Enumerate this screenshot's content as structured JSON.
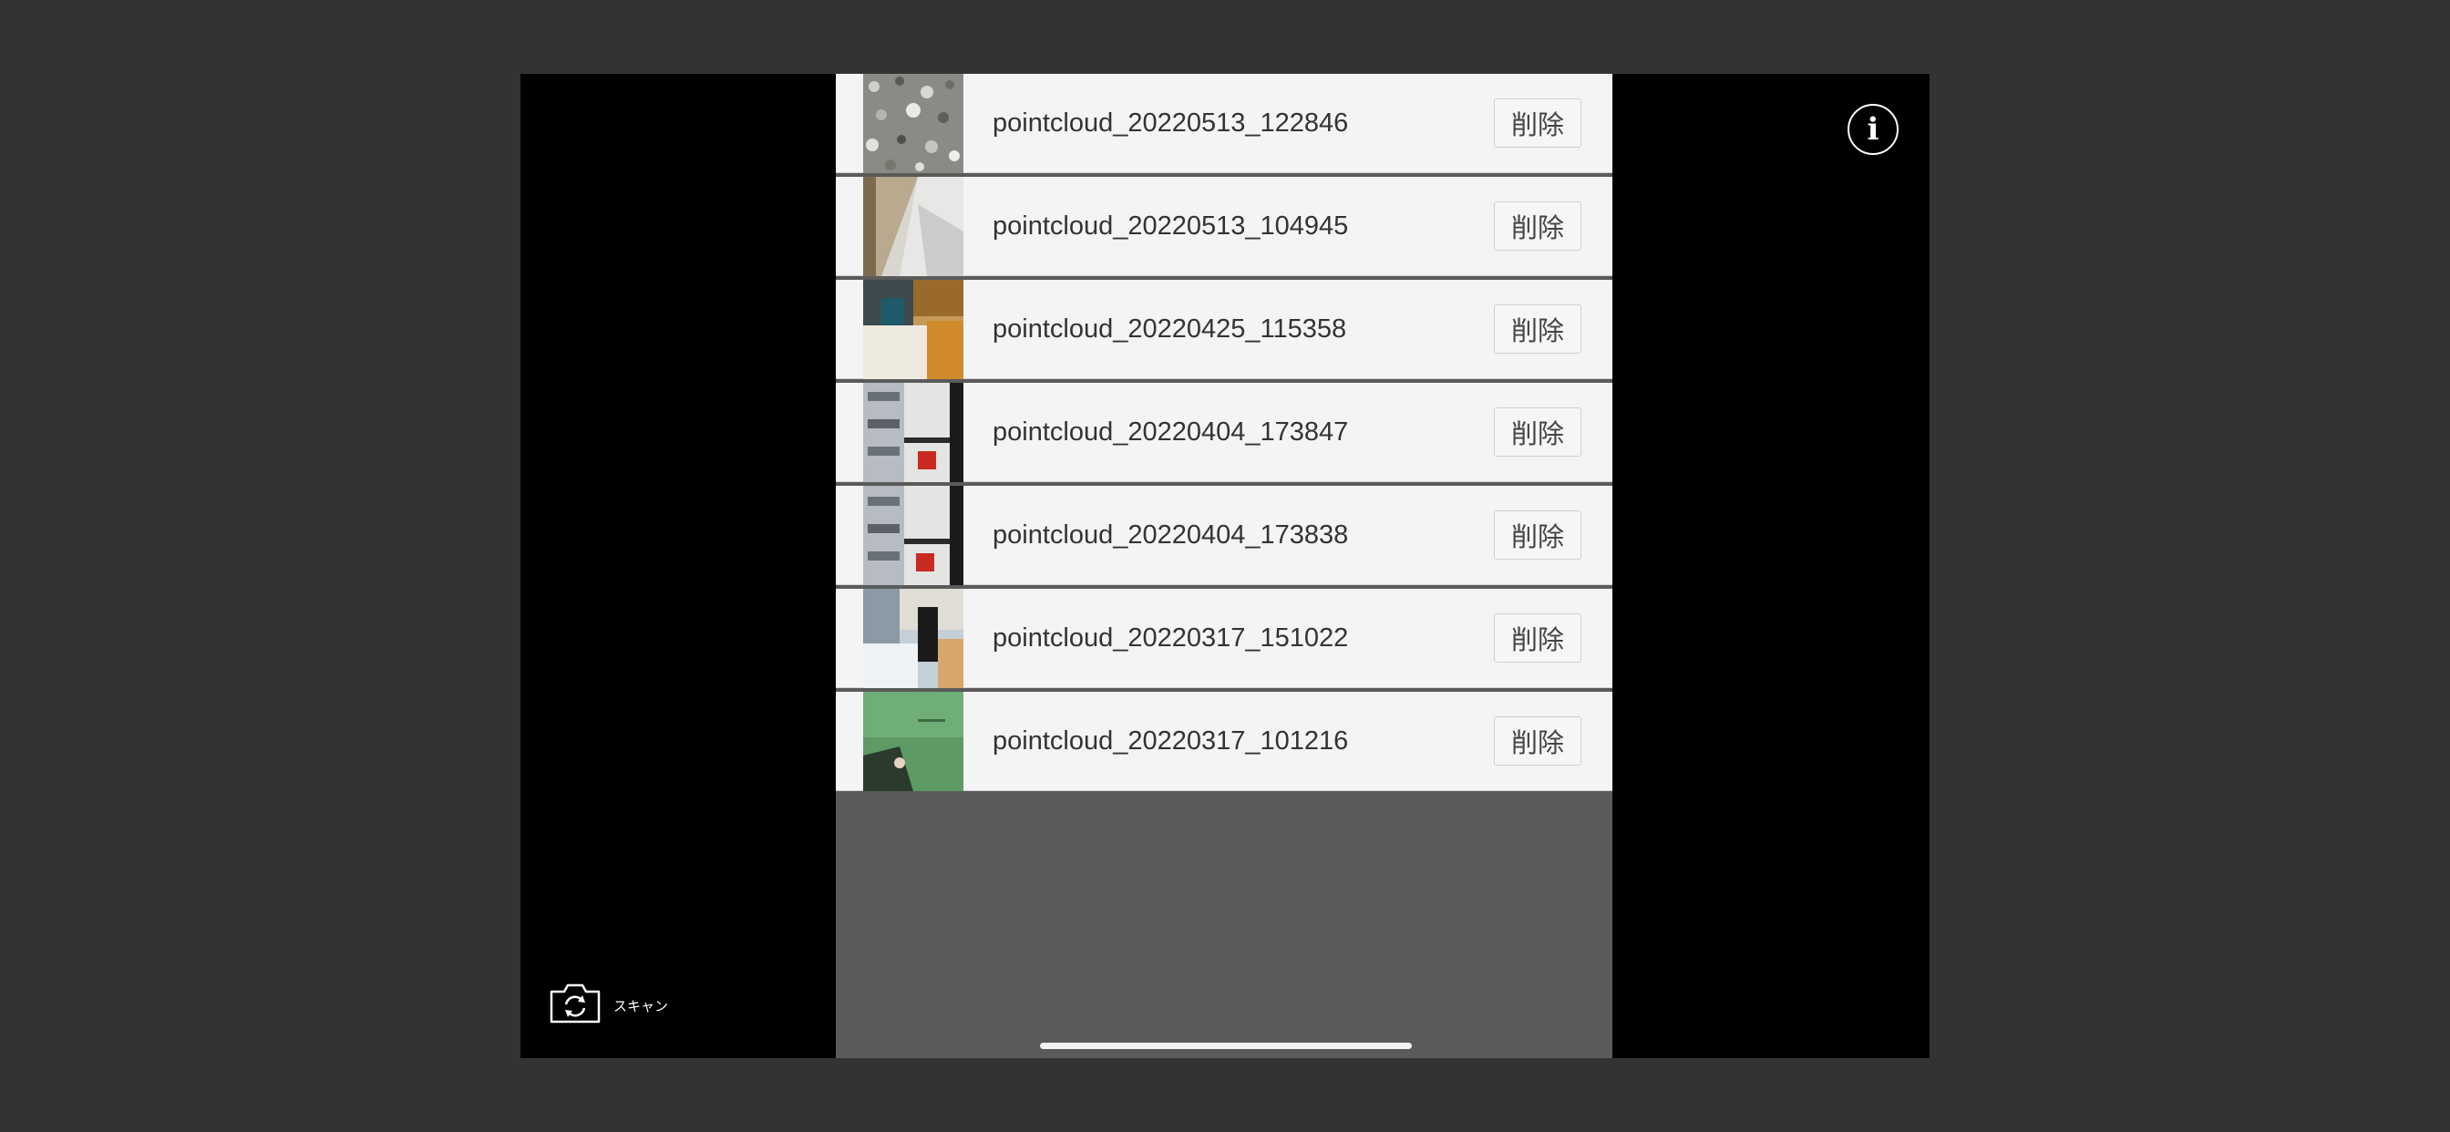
{
  "list": {
    "items": [
      {
        "name": "pointcloud_20220513_122846",
        "delete_label": "削除",
        "thumb": "gravel"
      },
      {
        "name": "pointcloud_20220513_104945",
        "delete_label": "削除",
        "thumb": "room-light"
      },
      {
        "name": "pointcloud_20220425_115358",
        "delete_label": "削除",
        "thumb": "office-warm"
      },
      {
        "name": "pointcloud_20220404_173847",
        "delete_label": "削除",
        "thumb": "shelves"
      },
      {
        "name": "pointcloud_20220404_173838",
        "delete_label": "削除",
        "thumb": "shelves"
      },
      {
        "name": "pointcloud_20220317_151022",
        "delete_label": "削除",
        "thumb": "office-blue"
      },
      {
        "name": "pointcloud_20220317_101216",
        "delete_label": "削除",
        "thumb": "green-floor"
      }
    ]
  },
  "scan": {
    "label": "スキャン",
    "icon": "camera-rotate-icon"
  },
  "info": {
    "icon": "info-icon",
    "glyph": "i"
  },
  "colors": {
    "background": "#333333",
    "device": "#000000",
    "row": "#f4f4f4",
    "panel": "#5a5a5a"
  }
}
